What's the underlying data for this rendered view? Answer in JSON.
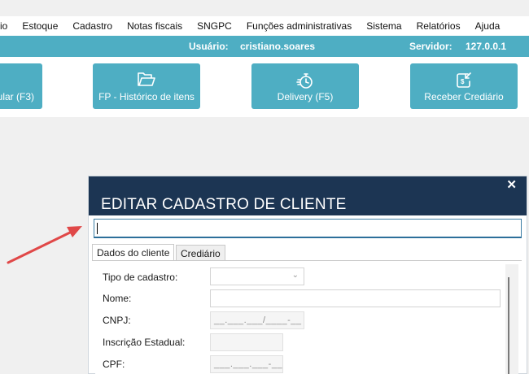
{
  "menu": [
    "io",
    "Estoque",
    "Cadastro",
    "Notas fiscais",
    "SNGPC",
    "Funções administrativas",
    "Sistema",
    "Relatórios",
    "Ajuda"
  ],
  "userbar": {
    "user_label": "Usuário:",
    "user_value": "cristiano.soares",
    "server_label": "Servidor:",
    "server_value": "127.0.0.1"
  },
  "toolbar": {
    "btn1": "ular (F3)",
    "btn2": "FP - Histórico de itens",
    "btn3": "Delivery (F5)",
    "btn4": "Receber Crediário"
  },
  "modal": {
    "title": "EDITAR CADASTRO DE CLIENTE",
    "close": "✕",
    "search_value": "",
    "tabs": [
      "Dados do cliente",
      "Crediário"
    ],
    "fields": {
      "tipo_label": "Tipo de cadastro:",
      "tipo_value": "",
      "nome_label": "Nome:",
      "nome_value": "",
      "cnpj_label": "CNPJ:",
      "cnpj_mask": "__.___.___/____-__",
      "ie_label": "Inscrição Estadual:",
      "ie_value": "",
      "cpf_label": "CPF:",
      "cpf_mask": "___.___.___-__"
    }
  },
  "colors": {
    "teal": "#4eaec3",
    "navy": "#1c3553",
    "arrow": "#e04848"
  },
  "icons": {
    "btn2": "folder-icon",
    "btn3": "delivery-timer-icon",
    "btn4": "receive-money-icon",
    "arrow": "red-arrow-icon"
  }
}
